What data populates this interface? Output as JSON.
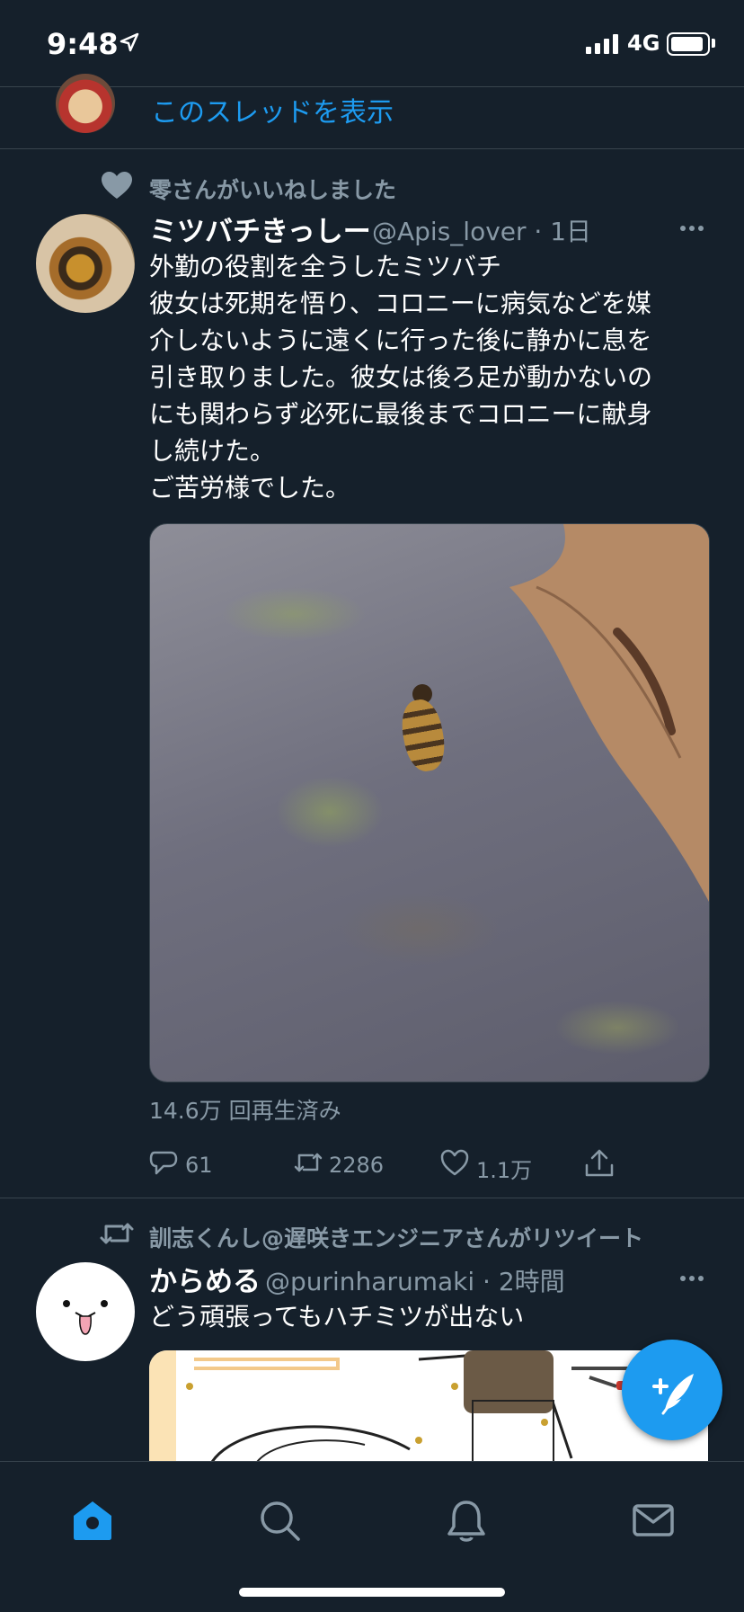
{
  "status_bar": {
    "time": "9:48",
    "network": "4G"
  },
  "thread_link": {
    "label": "このスレッドを表示"
  },
  "tweet1": {
    "social_context": "零さんがいいねしました",
    "author_name": "ミツバチきっしー",
    "handle_time": "@Apis_lover · 1日",
    "text_lines": [
      "外勤の役割を全うしたミツバチ",
      "彼女は死期を悟り、コロニーに病気などを媒",
      "介しないように遠くに行った後に静かに息を",
      "引き取りました。彼女は後ろ足が動かないの",
      "にも関わらず必死に最後までコロニーに献身",
      "し続けた。",
      "ご苦労様でした。"
    ],
    "views": "14.6万 回再生済み",
    "actions": {
      "replies": "61",
      "retweets": "2286",
      "likes": "1.1万"
    }
  },
  "tweet2": {
    "social_context": "訓志くんし@遅咲きエンジニアさんがリツイート",
    "author_name": "からめる",
    "handle_time": "@purinharumaki · 2時間",
    "text": "どう頑張ってもハチミツが出ない"
  },
  "colors": {
    "background": "#15202b",
    "accent": "#1d9bf0",
    "secondary_text": "#8899a6",
    "divider": "#38444d"
  }
}
